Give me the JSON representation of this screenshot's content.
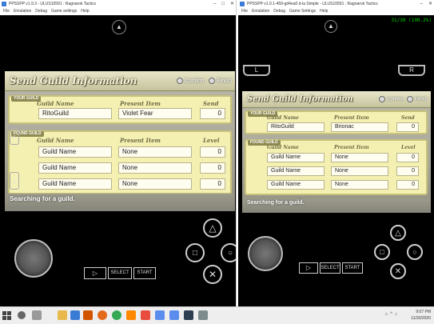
{
  "left": {
    "title": "PPSSPP v1.9.3 - ULUS10591 : Ragnarok Tactics",
    "menu": [
      "File",
      "Emulation",
      "Debug",
      "Game settings",
      "Help"
    ],
    "screen_title": "Send Guild Information",
    "confirm_label": "Confirm",
    "finish_label": "Finish",
    "your_label": "YOUR GUILD",
    "found_label": "FOUND GUILD",
    "col_guild": "Guild Name",
    "col_item": "Present Item",
    "col_send": "Send",
    "col_level": "Level",
    "your": {
      "name": "RitoGuild",
      "item": "Violet Fear",
      "send": "0"
    },
    "found": [
      {
        "name": "Guild Name",
        "item": "None",
        "level": "0"
      },
      {
        "name": "Guild Name",
        "item": "None",
        "level": "0"
      },
      {
        "name": "Guild Name",
        "item": "None",
        "level": "0"
      }
    ],
    "status": "Searching for a guild.",
    "select_label": "SELECT",
    "start_label": "START",
    "arrow_left": "‹",
    "arrow_right": "›",
    "triangle_top": "▲"
  },
  "right": {
    "title": "PPSSPP v1.0.1-459-gd4ea0 d-la Simple - ULUS10591 : Ragnarok Tactics",
    "menu": [
      "File",
      "Emulation",
      "Debug",
      "Game Settings",
      "Help"
    ],
    "fps": "31/30 (100.2%)",
    "screen_title": "Send Guild Information",
    "confirm_label": "Confirm",
    "finish_label": "Finish",
    "your_label": "YOUR GUILD",
    "found_label": "FOUND GUILD",
    "col_guild": "Guild Name",
    "col_item": "Present Item",
    "col_send": "Send",
    "col_level": "Level",
    "your": {
      "name": "RitoGuild",
      "item": "Brionac",
      "send": "0"
    },
    "found": [
      {
        "name": "Guild Name",
        "item": "None",
        "level": "0"
      },
      {
        "name": "Guild Name",
        "item": "None",
        "level": "0"
      },
      {
        "name": "Guild Name",
        "item": "None",
        "level": "0"
      }
    ],
    "status": "Searching for a guild.",
    "select_label": "SELECT",
    "start_label": "START",
    "l_label": "L",
    "r_label": "R",
    "triangle_top": "▲"
  },
  "taskbar": {
    "time": "9:07 PM",
    "date": "11/30/2020",
    "apps": [
      "file-explorer",
      "store",
      "firefox",
      "chrome",
      "vlc",
      "ppsspp",
      "ppsspp",
      "mail",
      "photos",
      "settings",
      "game"
    ]
  },
  "colors": {
    "panel": "#f4f0b2",
    "fps": "#00d400"
  }
}
